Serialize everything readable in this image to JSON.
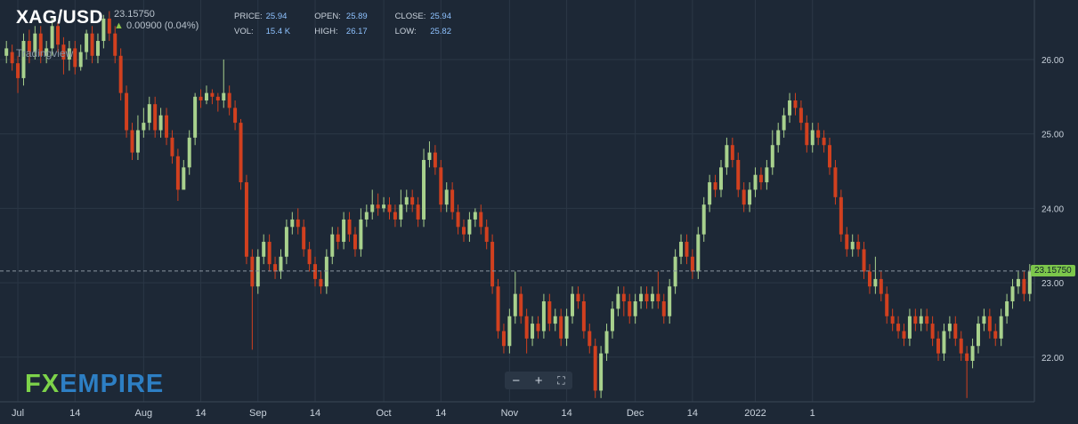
{
  "header": {
    "symbol": "XAG/USD",
    "last_price": "23.15750",
    "change": "0.00900 (0.04%)",
    "change_direction": "up",
    "stats": [
      {
        "label": "PRICE:",
        "value": "25.94"
      },
      {
        "label": "OPEN:",
        "value": "25.89"
      },
      {
        "label": "CLOSE:",
        "value": "25.94"
      },
      {
        "label": "VOL:",
        "value": "15.4 K"
      },
      {
        "label": "HIGH:",
        "value": "26.17"
      },
      {
        "label": "LOW:",
        "value": "25.82"
      }
    ]
  },
  "watermark": "Tradingview",
  "logo": {
    "fx": "FX",
    "empire": "EMPIRE"
  },
  "zoom_controls": {
    "minus": "−",
    "plus": "+",
    "fullscreen": "⛶"
  },
  "colors": {
    "background": "#1d2836",
    "up": "#a8d18d",
    "down": "#d1401f",
    "grid": "#2b3746",
    "axis_text": "#c9d2dc",
    "current_line": "#8a94a0",
    "price_tag": "#7cc64b"
  },
  "chart_data": {
    "type": "candlestick",
    "y_axis": {
      "min": 21.4,
      "max": 26.8,
      "ticks": [
        22.0,
        23.0,
        24.0,
        25.0,
        26.0
      ],
      "tick_labels": [
        "22.00",
        "23.00",
        "24.00",
        "25.00",
        "26.00"
      ],
      "position": "right"
    },
    "x_axis": {
      "labels": [
        "Jul",
        "14",
        "Aug",
        "14",
        "Sep",
        "14",
        "Oct",
        "14",
        "Nov",
        "14",
        "Dec",
        "14",
        "2022",
        "1"
      ],
      "label_index": [
        2,
        12,
        24,
        34,
        44,
        54,
        66,
        76,
        88,
        98,
        110,
        120,
        131,
        141
      ]
    },
    "current_price": 23.1575,
    "current_price_label": "23.15750",
    "grid": true,
    "candles": [
      [
        26.05,
        26.15,
        26.25,
        25.95
      ],
      [
        26.1,
        25.95,
        26.2,
        25.85
      ],
      [
        25.95,
        25.75,
        26.05,
        25.55
      ],
      [
        25.75,
        26.25,
        26.35,
        25.65
      ],
      [
        26.25,
        26.1,
        26.4,
        25.95
      ],
      [
        26.1,
        26.35,
        26.45,
        26.0
      ],
      [
        26.35,
        26.05,
        26.45,
        25.95
      ],
      [
        26.05,
        26.15,
        26.25,
        25.95
      ],
      [
        26.15,
        26.45,
        26.55,
        26.05
      ],
      [
        26.45,
        26.2,
        26.5,
        26.1
      ],
      [
        26.2,
        26.0,
        26.3,
        25.8
      ],
      [
        26.0,
        26.15,
        26.25,
        25.85
      ],
      [
        26.15,
        25.9,
        26.25,
        25.8
      ],
      [
        25.9,
        26.1,
        26.2,
        25.85
      ],
      [
        26.1,
        26.35,
        26.4,
        26.0
      ],
      [
        26.35,
        26.05,
        26.45,
        25.95
      ],
      [
        26.05,
        26.25,
        26.35,
        25.95
      ],
      [
        26.25,
        26.55,
        26.6,
        26.15
      ],
      [
        26.55,
        26.35,
        26.65,
        26.25
      ],
      [
        26.35,
        26.05,
        26.45,
        25.95
      ],
      [
        26.05,
        25.55,
        26.15,
        25.45
      ],
      [
        25.55,
        25.05,
        25.65,
        24.95
      ],
      [
        25.05,
        24.75,
        25.15,
        24.65
      ],
      [
        24.75,
        25.05,
        25.25,
        24.65
      ],
      [
        25.05,
        25.15,
        25.35,
        24.95
      ],
      [
        25.15,
        25.4,
        25.5,
        25.05
      ],
      [
        25.4,
        25.05,
        25.5,
        24.95
      ],
      [
        25.05,
        25.25,
        25.35,
        24.95
      ],
      [
        25.25,
        24.95,
        25.35,
        24.85
      ],
      [
        24.95,
        24.7,
        25.05,
        24.6
      ],
      [
        24.7,
        24.25,
        24.8,
        24.1
      ],
      [
        24.25,
        24.55,
        24.65,
        24.45
      ],
      [
        24.55,
        24.95,
        25.05,
        24.45
      ],
      [
        24.95,
        25.5,
        25.55,
        24.85
      ],
      [
        25.5,
        25.45,
        25.6,
        25.35
      ],
      [
        25.45,
        25.55,
        25.65,
        25.4
      ],
      [
        25.55,
        25.5,
        25.6,
        25.4
      ],
      [
        25.5,
        25.45,
        25.55,
        25.3
      ],
      [
        25.45,
        25.55,
        26.0,
        25.35
      ],
      [
        25.55,
        25.35,
        25.65,
        25.25
      ],
      [
        25.35,
        25.15,
        25.45,
        25.05
      ],
      [
        25.15,
        24.35,
        25.2,
        24.25
      ],
      [
        24.35,
        23.35,
        24.45,
        23.25
      ],
      [
        23.35,
        22.95,
        23.45,
        22.1
      ],
      [
        22.95,
        23.35,
        23.45,
        22.85
      ],
      [
        23.35,
        23.55,
        23.65,
        23.25
      ],
      [
        23.55,
        23.25,
        23.65,
        23.15
      ],
      [
        23.25,
        23.15,
        23.35,
        23.05
      ],
      [
        23.15,
        23.35,
        23.45,
        23.05
      ],
      [
        23.35,
        23.75,
        23.85,
        23.25
      ],
      [
        23.75,
        23.85,
        23.95,
        23.65
      ],
      [
        23.85,
        23.75,
        24.0,
        23.65
      ],
      [
        23.75,
        23.45,
        23.85,
        23.35
      ],
      [
        23.45,
        23.25,
        23.55,
        23.15
      ],
      [
        23.25,
        23.05,
        23.35,
        22.95
      ],
      [
        23.05,
        22.95,
        23.15,
        22.85
      ],
      [
        22.95,
        23.35,
        23.45,
        22.85
      ],
      [
        23.35,
        23.65,
        23.75,
        23.25
      ],
      [
        23.65,
        23.55,
        23.75,
        23.45
      ],
      [
        23.55,
        23.85,
        23.95,
        23.45
      ],
      [
        23.85,
        23.65,
        23.95,
        23.55
      ],
      [
        23.65,
        23.45,
        23.75,
        23.35
      ],
      [
        23.45,
        23.85,
        24.0,
        23.35
      ],
      [
        23.85,
        23.95,
        24.05,
        23.75
      ],
      [
        23.95,
        24.05,
        24.25,
        23.85
      ],
      [
        24.05,
        24.0,
        24.2,
        23.9
      ],
      [
        24.0,
        24.05,
        24.15,
        23.95
      ],
      [
        24.05,
        23.95,
        24.15,
        23.85
      ],
      [
        23.95,
        23.85,
        24.05,
        23.75
      ],
      [
        23.85,
        24.05,
        24.25,
        23.75
      ],
      [
        24.05,
        24.15,
        24.25,
        23.95
      ],
      [
        24.15,
        24.05,
        24.25,
        23.95
      ],
      [
        24.05,
        23.85,
        24.15,
        23.75
      ],
      [
        23.85,
        24.65,
        24.8,
        23.75
      ],
      [
        24.65,
        24.75,
        24.9,
        24.55
      ],
      [
        24.75,
        24.55,
        24.85,
        24.45
      ],
      [
        24.55,
        24.05,
        24.65,
        23.95
      ],
      [
        24.05,
        24.25,
        24.35,
        23.95
      ],
      [
        24.25,
        23.95,
        24.35,
        23.85
      ],
      [
        23.95,
        23.75,
        24.05,
        23.65
      ],
      [
        23.75,
        23.65,
        23.85,
        23.55
      ],
      [
        23.65,
        23.85,
        23.95,
        23.55
      ],
      [
        23.85,
        23.95,
        24.0,
        23.75
      ],
      [
        23.95,
        23.75,
        24.05,
        23.65
      ],
      [
        23.75,
        23.55,
        23.85,
        23.45
      ],
      [
        23.55,
        22.95,
        23.65,
        22.85
      ],
      [
        22.95,
        22.35,
        23.05,
        22.25
      ],
      [
        22.35,
        22.15,
        22.45,
        22.05
      ],
      [
        22.15,
        22.55,
        22.65,
        22.05
      ],
      [
        22.55,
        22.85,
        23.15,
        22.45
      ],
      [
        22.85,
        22.55,
        22.95,
        22.45
      ],
      [
        22.55,
        22.25,
        22.65,
        22.05
      ],
      [
        22.25,
        22.45,
        22.55,
        22.15
      ],
      [
        22.45,
        22.35,
        22.55,
        22.25
      ],
      [
        22.35,
        22.75,
        22.85,
        22.25
      ],
      [
        22.75,
        22.45,
        22.85,
        22.35
      ],
      [
        22.45,
        22.55,
        22.65,
        22.35
      ],
      [
        22.55,
        22.25,
        22.65,
        22.15
      ],
      [
        22.25,
        22.55,
        22.65,
        22.15
      ],
      [
        22.55,
        22.85,
        22.95,
        22.45
      ],
      [
        22.85,
        22.75,
        22.95,
        22.65
      ],
      [
        22.75,
        22.35,
        22.85,
        22.25
      ],
      [
        22.35,
        22.15,
        22.45,
        22.05
      ],
      [
        22.15,
        21.55,
        22.25,
        21.45
      ],
      [
        21.55,
        22.05,
        22.15,
        21.45
      ],
      [
        22.05,
        22.35,
        22.45,
        21.95
      ],
      [
        22.35,
        22.65,
        22.75,
        22.25
      ],
      [
        22.65,
        22.85,
        22.95,
        22.55
      ],
      [
        22.85,
        22.75,
        22.95,
        22.55
      ],
      [
        22.75,
        22.55,
        22.85,
        22.45
      ],
      [
        22.55,
        22.75,
        22.85,
        22.45
      ],
      [
        22.75,
        22.85,
        22.95,
        22.65
      ],
      [
        22.85,
        22.75,
        22.95,
        22.65
      ],
      [
        22.75,
        22.85,
        22.95,
        22.65
      ],
      [
        22.85,
        22.75,
        23.15,
        22.65
      ],
      [
        22.75,
        22.55,
        22.85,
        22.45
      ],
      [
        22.55,
        22.95,
        23.05,
        22.45
      ],
      [
        22.95,
        23.35,
        23.45,
        22.85
      ],
      [
        23.35,
        23.55,
        23.65,
        23.25
      ],
      [
        23.55,
        23.35,
        23.65,
        23.25
      ],
      [
        23.35,
        23.15,
        23.45,
        23.05
      ],
      [
        23.15,
        23.65,
        23.75,
        23.05
      ],
      [
        23.65,
        24.05,
        24.15,
        23.55
      ],
      [
        24.05,
        24.35,
        24.45,
        23.95
      ],
      [
        24.35,
        24.25,
        24.45,
        24.15
      ],
      [
        24.25,
        24.55,
        24.65,
        24.15
      ],
      [
        24.55,
        24.85,
        24.95,
        24.45
      ],
      [
        24.85,
        24.65,
        24.95,
        24.55
      ],
      [
        24.65,
        24.25,
        24.75,
        24.15
      ],
      [
        24.25,
        24.05,
        24.35,
        23.95
      ],
      [
        24.05,
        24.25,
        24.35,
        23.95
      ],
      [
        24.25,
        24.45,
        24.55,
        24.15
      ],
      [
        24.45,
        24.35,
        24.55,
        24.25
      ],
      [
        24.35,
        24.55,
        24.65,
        24.25
      ],
      [
        24.55,
        24.85,
        25.05,
        24.45
      ],
      [
        24.85,
        25.05,
        25.15,
        24.75
      ],
      [
        25.05,
        25.25,
        25.35,
        24.95
      ],
      [
        25.25,
        25.45,
        25.55,
        25.15
      ],
      [
        25.45,
        25.35,
        25.55,
        25.25
      ],
      [
        25.35,
        25.15,
        25.45,
        25.05
      ],
      [
        25.15,
        24.85,
        25.25,
        24.75
      ],
      [
        24.85,
        25.05,
        25.15,
        24.75
      ],
      [
        25.05,
        24.95,
        25.15,
        24.85
      ],
      [
        24.95,
        24.85,
        25.05,
        24.75
      ],
      [
        24.85,
        24.55,
        24.95,
        24.45
      ],
      [
        24.55,
        24.15,
        24.65,
        24.05
      ],
      [
        24.15,
        23.65,
        24.25,
        23.55
      ],
      [
        23.65,
        23.45,
        23.75,
        23.35
      ],
      [
        23.45,
        23.55,
        23.65,
        23.35
      ],
      [
        23.55,
        23.45,
        23.65,
        23.35
      ],
      [
        23.45,
        23.15,
        23.55,
        23.05
      ],
      [
        23.15,
        22.95,
        23.25,
        22.85
      ],
      [
        22.95,
        23.05,
        23.35,
        22.85
      ],
      [
        23.05,
        22.85,
        23.15,
        22.75
      ],
      [
        22.85,
        22.55,
        22.95,
        22.45
      ],
      [
        22.55,
        22.45,
        22.65,
        22.35
      ],
      [
        22.45,
        22.35,
        22.55,
        22.25
      ],
      [
        22.35,
        22.25,
        22.45,
        22.15
      ],
      [
        22.25,
        22.55,
        22.65,
        22.15
      ],
      [
        22.55,
        22.45,
        22.65,
        22.35
      ],
      [
        22.45,
        22.55,
        22.65,
        22.35
      ],
      [
        22.55,
        22.45,
        22.65,
        22.35
      ],
      [
        22.45,
        22.25,
        22.55,
        22.15
      ],
      [
        22.25,
        22.05,
        22.35,
        21.95
      ],
      [
        22.05,
        22.35,
        22.45,
        21.95
      ],
      [
        22.35,
        22.45,
        22.55,
        22.25
      ],
      [
        22.45,
        22.25,
        22.55,
        22.15
      ],
      [
        22.25,
        22.05,
        22.35,
        21.95
      ],
      [
        22.05,
        21.95,
        22.15,
        21.45
      ],
      [
        21.95,
        22.15,
        22.25,
        21.85
      ],
      [
        22.15,
        22.45,
        22.55,
        22.05
      ],
      [
        22.45,
        22.55,
        22.65,
        22.35
      ],
      [
        22.55,
        22.35,
        22.65,
        22.25
      ],
      [
        22.35,
        22.25,
        22.45,
        22.15
      ],
      [
        22.25,
        22.55,
        22.65,
        22.15
      ],
      [
        22.55,
        22.75,
        22.85,
        22.45
      ],
      [
        22.75,
        22.95,
        23.05,
        22.65
      ],
      [
        22.95,
        23.05,
        23.15,
        22.85
      ],
      [
        23.05,
        22.85,
        23.15,
        22.75
      ],
      [
        22.85,
        23.15,
        23.25,
        22.75
      ]
    ]
  }
}
